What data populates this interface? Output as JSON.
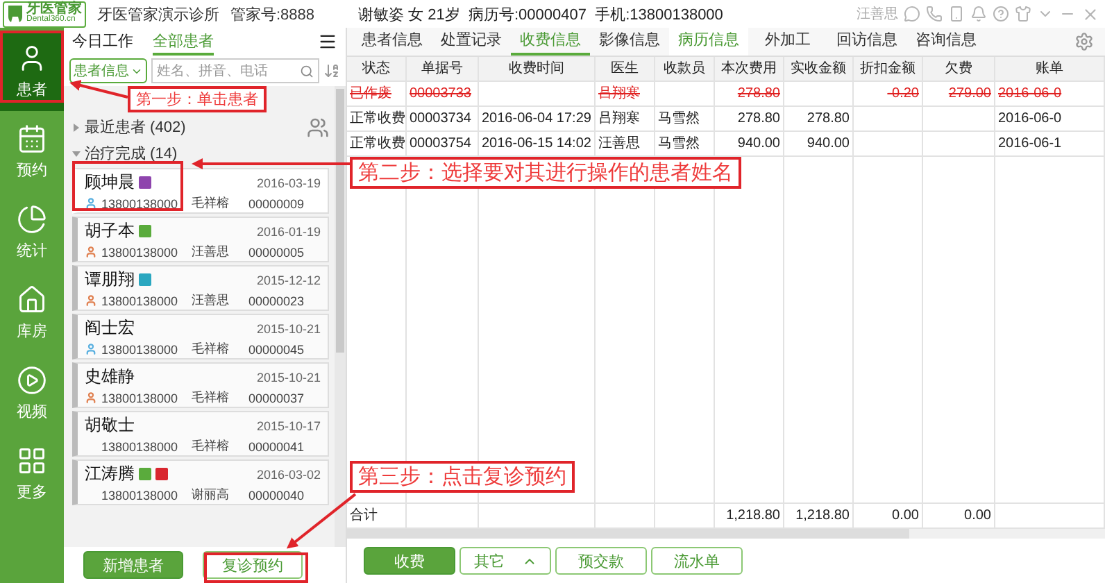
{
  "header": {
    "logo_name": "牙医管家",
    "logo_site": "Dental360.cn",
    "clinic": "牙医管家演示诊所",
    "account": "管家号:8888"
  },
  "nav": [
    {
      "label": "患者",
      "selected": true
    },
    {
      "label": "预约",
      "selected": false
    },
    {
      "label": "统计",
      "selected": false
    },
    {
      "label": "库房",
      "selected": false
    },
    {
      "label": "视频",
      "selected": false
    },
    {
      "label": "更多",
      "selected": false
    }
  ],
  "list_tabs": [
    {
      "label": "今日工作",
      "selected": false
    },
    {
      "label": "全部患者",
      "selected": true
    }
  ],
  "search": {
    "filter": "患者信息",
    "placeholder": "姓名、拼音、电话"
  },
  "groups": [
    {
      "label": "最近患者 (402)",
      "expanded": false
    },
    {
      "label": "治疗完成 (14)",
      "expanded": true
    }
  ],
  "patients": [
    {
      "name": "顾坤晨",
      "tags": [
        {
          "color": "#8e44ad"
        }
      ],
      "date": "2016-03-19",
      "kind": "male",
      "phone": "13800138000",
      "doctor": "毛祥榕",
      "number": "00000009",
      "selected": true
    },
    {
      "name": "胡子本",
      "tags": [
        {
          "color": "#5aab3c"
        }
      ],
      "date": "2016-01-19",
      "kind": "female",
      "phone": "13800138000",
      "doctor": "汪善思",
      "number": "00000005",
      "selected": false
    },
    {
      "name": "谭朋翔",
      "tags": [
        {
          "color": "#2aa7c0"
        }
      ],
      "date": "2015-12-12",
      "kind": "female",
      "phone": "13800138000",
      "doctor": "汪善思",
      "number": "00000023",
      "selected": false
    },
    {
      "name": "阎士宏",
      "date": "2015-10-21",
      "kind": "male",
      "phone": "13800138000",
      "doctor": "毛祥榕",
      "number": "00000045",
      "selected": false
    },
    {
      "name": "史雄静",
      "date": "2015-10-21",
      "kind": "female",
      "phone": "13800138000",
      "doctor": "毛祥榕",
      "number": "00000037",
      "selected": false
    },
    {
      "name": "胡敬士",
      "date": "2015-10-17",
      "phone": "13800138000",
      "doctor": "毛祥榕",
      "number": "00000041",
      "selected": false
    },
    {
      "name": "江涛腾",
      "tags": [
        {
          "color": "#5aab3c"
        },
        {
          "color": "#d9262f"
        }
      ],
      "date": "2016-03-02",
      "phone": "13800138000",
      "doctor": "谢丽高",
      "number": "00000040",
      "selected": false
    }
  ],
  "list_buttons": [
    "新增患者",
    "复诊预约"
  ],
  "patient_info": "谢敏姿 女 21岁  病历号:00000407  手机:13800138000",
  "user": "汪善思",
  "tabs": [
    {
      "label": "患者信息",
      "selected": false,
      "highlighted": false
    },
    {
      "label": "处置记录",
      "selected": false,
      "highlighted": false
    },
    {
      "label": "收费信息",
      "selected": true,
      "highlighted": false
    },
    {
      "label": "影像信息",
      "selected": false,
      "highlighted": false
    },
    {
      "label": "病历信息",
      "selected": false,
      "highlighted": true
    },
    {
      "label": "外加工",
      "selected": false,
      "highlighted": false
    },
    {
      "label": "回访信息",
      "selected": false,
      "highlighted": false
    },
    {
      "label": "咨询信息",
      "selected": false,
      "highlighted": false
    }
  ],
  "table": {
    "columns": [
      "状态",
      "单据号",
      "收费时间",
      "医生",
      "收款员",
      "本次费用",
      "实收金额",
      "折扣金额",
      "欠费",
      "账单"
    ],
    "rows": [
      {
        "voided": true,
        "status": "已作废",
        "number": "00003733",
        "doctor": "吕翔寒",
        "cost": "278.80",
        "discount": "-0.20",
        "debt": "279.00",
        "bill": "2016-06-0"
      },
      {
        "voided": false,
        "status": "正常收费",
        "number": "00003734",
        "time": "2016-06-04 17:29",
        "doctor": "吕翔寒",
        "cashier": "马雪然",
        "cost": "278.80",
        "paid": "278.80",
        "bill": "2016-06-0"
      },
      {
        "voided": false,
        "status": "正常收费",
        "number": "00003754",
        "time": "2016-06-15 14:02",
        "doctor": "汪善思",
        "cashier": "马雪然",
        "cost": "940.00",
        "paid": "940.00",
        "bill": "2016-06-1"
      }
    ],
    "total": {
      "status": "合计",
      "cost": "1,218.80",
      "paid": "1,218.80",
      "discount": "0.00",
      "debt": "0.00"
    }
  },
  "buttons": [
    {
      "label": "收费",
      "kind": "primary"
    },
    {
      "label": "其它",
      "kind": "menu"
    },
    {
      "label": "预交款",
      "kind": "plain"
    },
    {
      "label": "流水单",
      "kind": "plain"
    }
  ],
  "annotations": [
    "第一步：单击患者",
    "第二步：选择要对其进行操作的患者姓名",
    "第三步：点击复诊预约"
  ]
}
